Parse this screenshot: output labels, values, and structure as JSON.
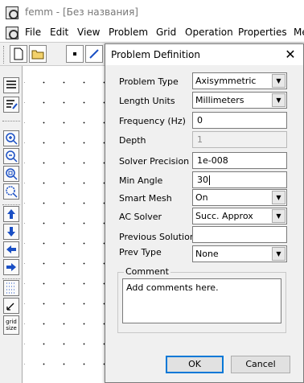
{
  "app": {
    "title": "femm - [Без названия]"
  },
  "menu": {
    "items": [
      "File",
      "Edit",
      "View",
      "Problem",
      "Grid",
      "Operation",
      "Properties",
      "Me"
    ]
  },
  "left_toolbar": {
    "grid_size_label": "grid size"
  },
  "dialog": {
    "title": "Problem Definition",
    "close_glyph": "✕",
    "fields": {
      "problem_type": {
        "label": "Problem Type",
        "value": "Axisymmetric"
      },
      "length_units": {
        "label": "Length Units",
        "value": "Millimeters"
      },
      "frequency": {
        "label": "Frequency (Hz)",
        "value": "0"
      },
      "depth": {
        "label": "Depth",
        "value": "1"
      },
      "solver_precision": {
        "label": "Solver Precision",
        "value": "1e-008"
      },
      "min_angle": {
        "label": "Min Angle",
        "value": "30"
      },
      "smart_mesh": {
        "label": "Smart Mesh",
        "value": "On"
      },
      "ac_solver": {
        "label": "AC Solver",
        "value": "Succ. Approx"
      },
      "previous_solution": {
        "label": "Previous Solution",
        "value": ""
      },
      "prev_type": {
        "label": "Prev Type",
        "value": "None"
      }
    },
    "comment": {
      "legend": "Comment",
      "text": "Add comments here."
    },
    "buttons": {
      "ok": "OK",
      "cancel": "Cancel"
    }
  },
  "colors": {
    "focus_border": "#0078d7",
    "dialog_bg": "#f0f0f0"
  }
}
